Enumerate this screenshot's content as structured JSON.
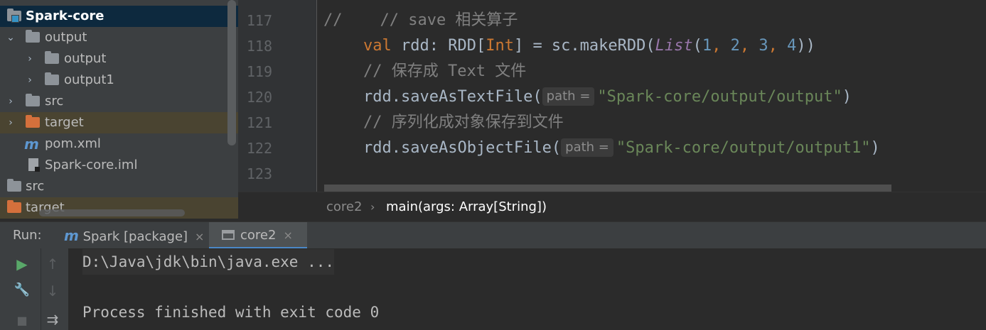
{
  "project_tree": {
    "items": [
      {
        "label": "Spark-core",
        "icon": "module-folder-icon",
        "arrow": "",
        "selected": true
      },
      {
        "label": "output",
        "icon": "folder-icon",
        "arrow": "v"
      },
      {
        "label": "output",
        "icon": "folder-icon",
        "arrow": ">"
      },
      {
        "label": "output1",
        "icon": "folder-icon",
        "arrow": ">"
      },
      {
        "label": "src",
        "icon": "folder-icon",
        "arrow": ">"
      },
      {
        "label": "target",
        "icon": "excluded-folder-icon",
        "arrow": ">"
      },
      {
        "label": "pom.xml",
        "icon": "maven-icon",
        "arrow": ""
      },
      {
        "label": "Spark-core.iml",
        "icon": "iml-file-icon",
        "arrow": ""
      },
      {
        "label": "src",
        "icon": "folder-icon",
        "arrow": ""
      },
      {
        "label": "target",
        "icon": "excluded-folder-icon",
        "arrow": ""
      }
    ]
  },
  "editor": {
    "line_numbers": [
      "117",
      "118",
      "119",
      "120",
      "121",
      "122",
      "123"
    ],
    "l117": {
      "comment": "//    // save 相关算子"
    },
    "l118": {
      "kw": "val",
      "t1": " rdd: RDD[",
      "type": "Int",
      "t2": "] = sc.makeRDD(",
      "fn": "List",
      "t3": "(",
      "n1": "1",
      "c1": ", ",
      "n2": "2",
      "c2": ", ",
      "n3": "3",
      "c3": ", ",
      "n4": "4",
      "t4": "))"
    },
    "l119": {
      "comment": "// 保存成 Text 文件"
    },
    "l120": {
      "t1": "rdd.saveAsTextFile(",
      "hint": "path =",
      "str": "\"Spark-core/output/output\"",
      "t2": ")"
    },
    "l121": {
      "comment": "// 序列化成对象保存到文件"
    },
    "l122": {
      "t1": "rdd.saveAsObjectFile(",
      "hint": "path =",
      "str": "\"Spark-core/output/output1\"",
      "t2": ")"
    }
  },
  "breadcrumb": {
    "object": "core2",
    "separator": "›",
    "method": "main(args: Array[String])"
  },
  "run_panel": {
    "title": "Run:",
    "tabs": [
      {
        "icon": "m",
        "label": "Spark [package]",
        "close": "×"
      },
      {
        "label": "core2",
        "close": "×"
      }
    ],
    "toolbar": {
      "run": "▶",
      "up": "↑",
      "wrench": "🔧",
      "down": "↓",
      "stop": "■",
      "wrap": "⇉"
    },
    "console": {
      "command": "D:\\Java\\jdk\\bin\\java.exe ...",
      "result": "Process finished with exit code 0"
    }
  },
  "colors": {
    "keyword": "#cc7832",
    "string": "#6a8759",
    "number": "#6897bb",
    "comment": "#808080",
    "selection": "#0d293e",
    "excluded": "#d4703c"
  }
}
